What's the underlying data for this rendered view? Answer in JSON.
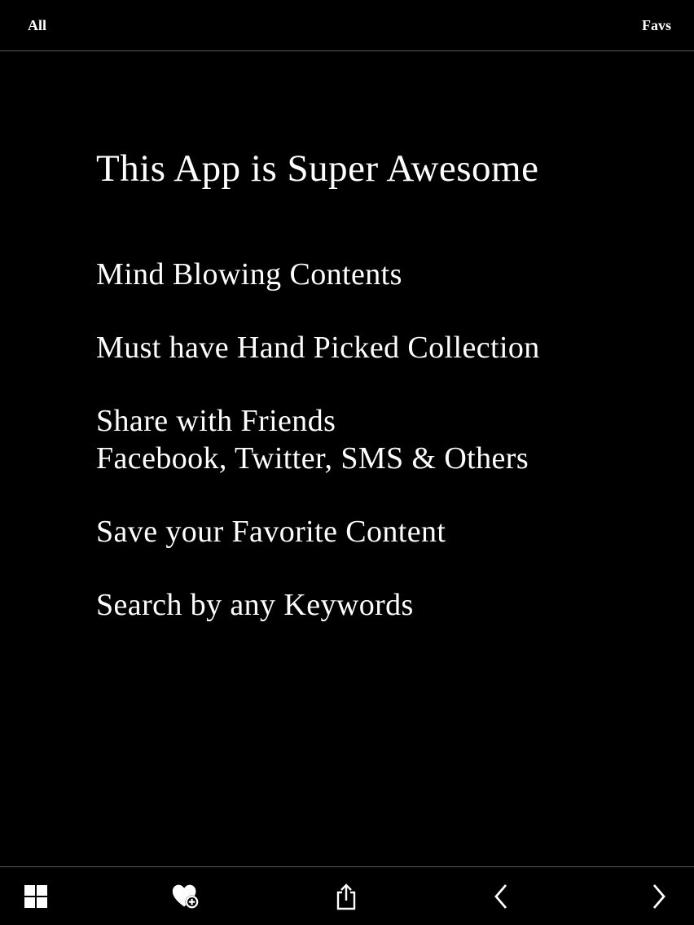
{
  "top_bar": {
    "left_label": "All",
    "right_label": "Favs"
  },
  "content": {
    "headline": "This App is Super Awesome",
    "features": [
      "Mind Blowing Contents",
      "Must have Hand Picked Collection",
      "Share with Friends",
      "Facebook, Twitter, SMS & Others",
      "Save your Favorite Content",
      "Search by any Keywords"
    ]
  },
  "bottom_toolbar": {
    "icons": [
      "grid-icon",
      "heart-add-icon",
      "share-icon",
      "chevron-left-icon",
      "chevron-right-icon"
    ]
  },
  "colors": {
    "background": "#000000",
    "text": "#ffffff",
    "divider": "#5a5a5a"
  }
}
